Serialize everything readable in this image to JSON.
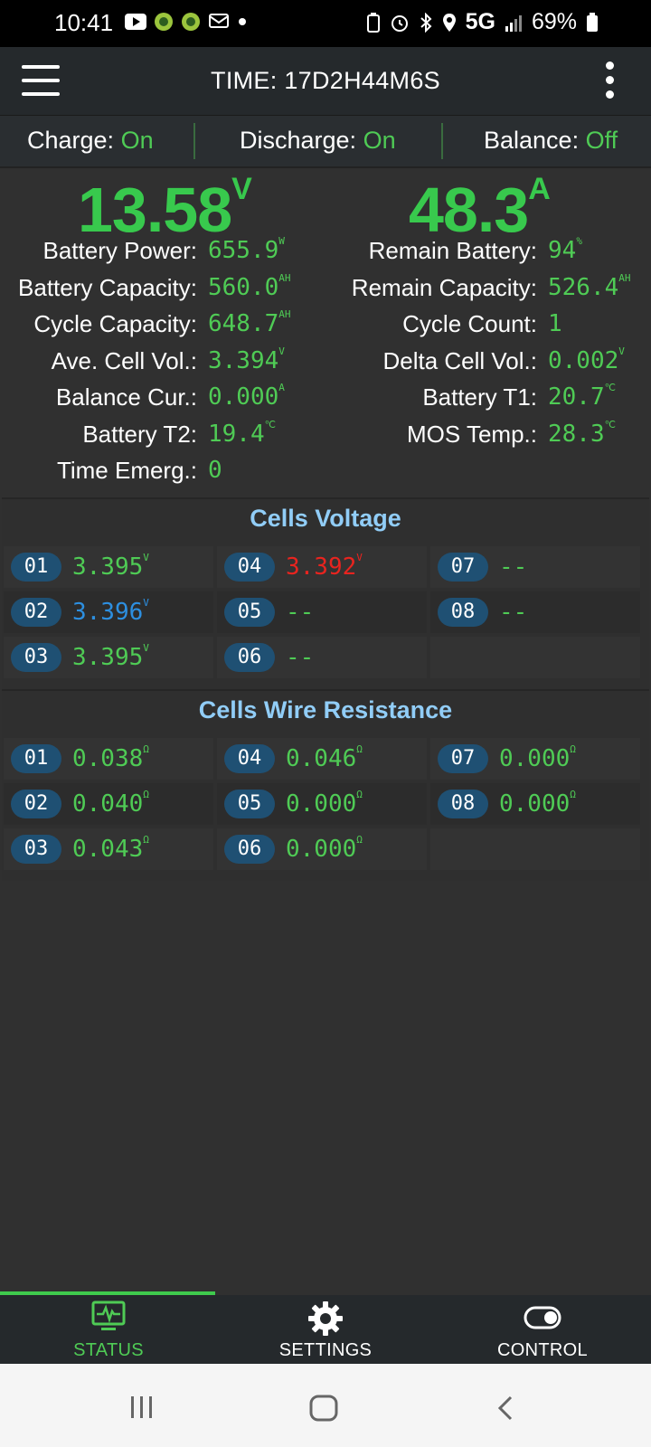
{
  "status_bar": {
    "time": "10:41",
    "network": "5G",
    "battery": "69%"
  },
  "header": {
    "title": "TIME: 17D2H44M6S"
  },
  "states": [
    {
      "key": "Charge: ",
      "value": "On"
    },
    {
      "key": "Discharge: ",
      "value": "On"
    },
    {
      "key": "Balance: ",
      "value": "Off"
    }
  ],
  "summary": {
    "voltage": "13.58",
    "voltage_unit": "V",
    "current": "48.3",
    "current_unit": "A"
  },
  "info": {
    "left": [
      {
        "label": "Battery Power:",
        "value": "655.9",
        "unit": "W"
      },
      {
        "label": "Battery Capacity:",
        "value": "560.0",
        "unit": "AH"
      },
      {
        "label": "Cycle Capacity:",
        "value": "648.7",
        "unit": "AH"
      },
      {
        "label": "Ave. Cell Vol.:",
        "value": "3.394",
        "unit": "V"
      },
      {
        "label": "Balance Cur.:",
        "value": "0.000",
        "unit": "A"
      },
      {
        "label": "Battery T2:",
        "value": "19.4",
        "unit": "℃"
      },
      {
        "label": "Time Emerg.:",
        "value": "0",
        "unit": ""
      }
    ],
    "right": [
      {
        "label": "Remain Battery:",
        "value": "94",
        "unit": "%"
      },
      {
        "label": "Remain Capacity:",
        "value": "526.4",
        "unit": "AH"
      },
      {
        "label": "Cycle Count:",
        "value": "1",
        "unit": ""
      },
      {
        "label": "Delta Cell Vol.:",
        "value": "0.002",
        "unit": "V"
      },
      {
        "label": "Battery T1:",
        "value": "20.7",
        "unit": "℃"
      },
      {
        "label": "MOS Temp.:",
        "value": "28.3",
        "unit": "℃"
      }
    ]
  },
  "cells_voltage": {
    "title": "Cells Voltage",
    "cells": [
      {
        "id": "01",
        "value": "3.395",
        "unit": "V",
        "color": "#4fcb55"
      },
      {
        "id": "02",
        "value": "3.396",
        "unit": "V",
        "color": "#2d8fe0"
      },
      {
        "id": "03",
        "value": "3.395",
        "unit": "V",
        "color": "#4fcb55"
      },
      {
        "id": "04",
        "value": "3.392",
        "unit": "V",
        "color": "#e8241f"
      },
      {
        "id": "05",
        "value": "--",
        "unit": "",
        "color": "#4fcb55"
      },
      {
        "id": "06",
        "value": "--",
        "unit": "",
        "color": "#4fcb55"
      },
      {
        "id": "07",
        "value": "--",
        "unit": "",
        "color": "#4fcb55"
      },
      {
        "id": "08",
        "value": "--",
        "unit": "",
        "color": "#4fcb55"
      }
    ]
  },
  "wire_resistance": {
    "title": "Cells Wire Resistance",
    "cells": [
      {
        "id": "01",
        "value": "0.038",
        "unit": "Ω"
      },
      {
        "id": "02",
        "value": "0.040",
        "unit": "Ω"
      },
      {
        "id": "03",
        "value": "0.043",
        "unit": "Ω"
      },
      {
        "id": "04",
        "value": "0.046",
        "unit": "Ω"
      },
      {
        "id": "05",
        "value": "0.000",
        "unit": "Ω"
      },
      {
        "id": "06",
        "value": "0.000",
        "unit": "Ω"
      },
      {
        "id": "07",
        "value": "0.000",
        "unit": "Ω"
      },
      {
        "id": "08",
        "value": "0.000",
        "unit": "Ω"
      }
    ]
  },
  "nav": {
    "active": "STATUS",
    "items": [
      {
        "label": "STATUS",
        "icon": "monitor-pulse-icon",
        "color": "#4fcb55"
      },
      {
        "label": "SETTINGS",
        "icon": "gear-icon",
        "color": "#ffffff"
      },
      {
        "label": "CONTROL",
        "icon": "toggle-icon",
        "color": "#ffffff"
      }
    ]
  },
  "colors": {
    "accent": "#4fcb55",
    "title_blue": "#91cdf7",
    "badge": "#1f5073"
  }
}
